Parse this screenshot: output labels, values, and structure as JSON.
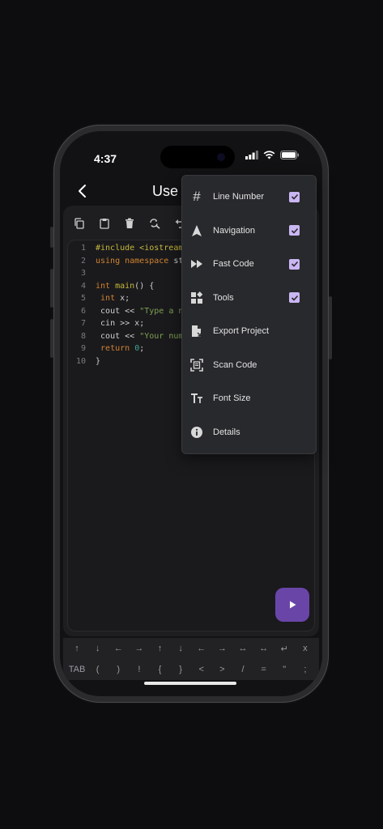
{
  "status_bar": {
    "time": "4:37"
  },
  "header": {
    "title": "Use"
  },
  "code": {
    "lines": [
      {
        "n": "1",
        "text": "#include <iostream>"
      },
      {
        "n": "2",
        "a": "using namespace",
        "b": " st"
      },
      {
        "n": "3"
      },
      {
        "n": "4",
        "a": "int",
        "b": " main",
        "c": "() {"
      },
      {
        "n": "5",
        "a": "int",
        "b": " x;"
      },
      {
        "n": "6",
        "a": "cout << ",
        "b": "\"Type a nu"
      },
      {
        "n": "7",
        "a": "cin >> x;"
      },
      {
        "n": "8",
        "a": "cout << ",
        "b": "\"Your num"
      },
      {
        "n": "9",
        "a": "return ",
        "b": "0",
        "c": ";"
      },
      {
        "n": "10",
        "a": "}"
      }
    ]
  },
  "menu": {
    "items": [
      {
        "label": "Line Number",
        "checked": true,
        "icon": "hash-icon"
      },
      {
        "label": "Navigation",
        "checked": true,
        "icon": "navigation-arrow-icon"
      },
      {
        "label": "Fast Code",
        "checked": true,
        "icon": "fast-forward-icon"
      },
      {
        "label": "Tools",
        "checked": true,
        "icon": "widgets-icon"
      },
      {
        "label": "Export Project",
        "checked": false,
        "icon": "file-export-icon"
      },
      {
        "label": "Scan Code",
        "checked": false,
        "icon": "scan-document-icon"
      },
      {
        "label": "Font Size",
        "checked": false,
        "icon": "text-size-icon"
      },
      {
        "label": "Details",
        "checked": false,
        "icon": "info-icon"
      }
    ]
  },
  "keyboard": {
    "row1": [
      "↑",
      "↓",
      "←",
      "→",
      "↑",
      "↓",
      "←",
      "→",
      "↔",
      "↔",
      "↵",
      "x"
    ],
    "row2": [
      "TAB",
      "(",
      ")",
      "!",
      "{",
      "}",
      "<",
      ">",
      "/",
      "=",
      "\"",
      ";"
    ]
  },
  "colors": {
    "accent": "#6a45a8",
    "check": "#c9b6f2",
    "background": "#0d0d10"
  }
}
